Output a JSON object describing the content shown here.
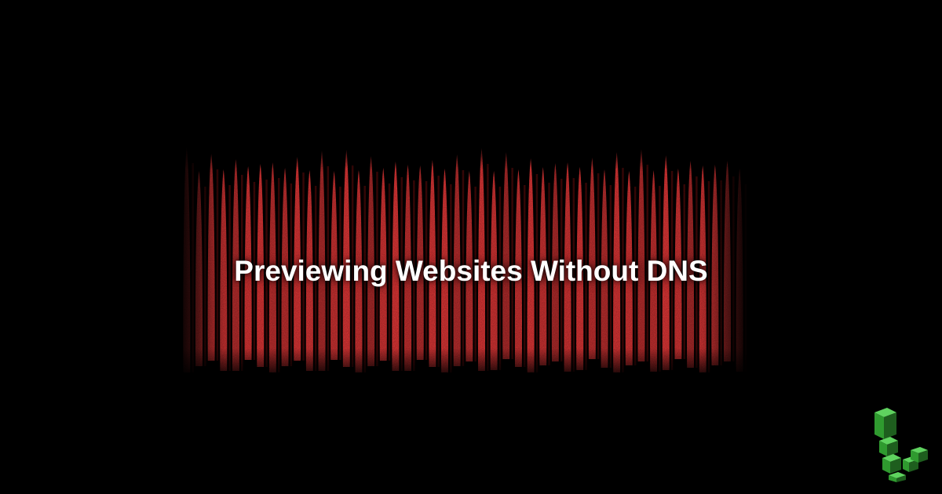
{
  "title": "Previewing Websites Without DNS",
  "colors": {
    "background": "#000000",
    "curtain": "#e03636",
    "curtain_shadow": "#4a0808",
    "title_text": "#ffffff",
    "logo_green": "#3bb73b",
    "logo_dark": "#1e5e1e"
  },
  "logo": {
    "icon": "linode-cube-logo-icon"
  }
}
